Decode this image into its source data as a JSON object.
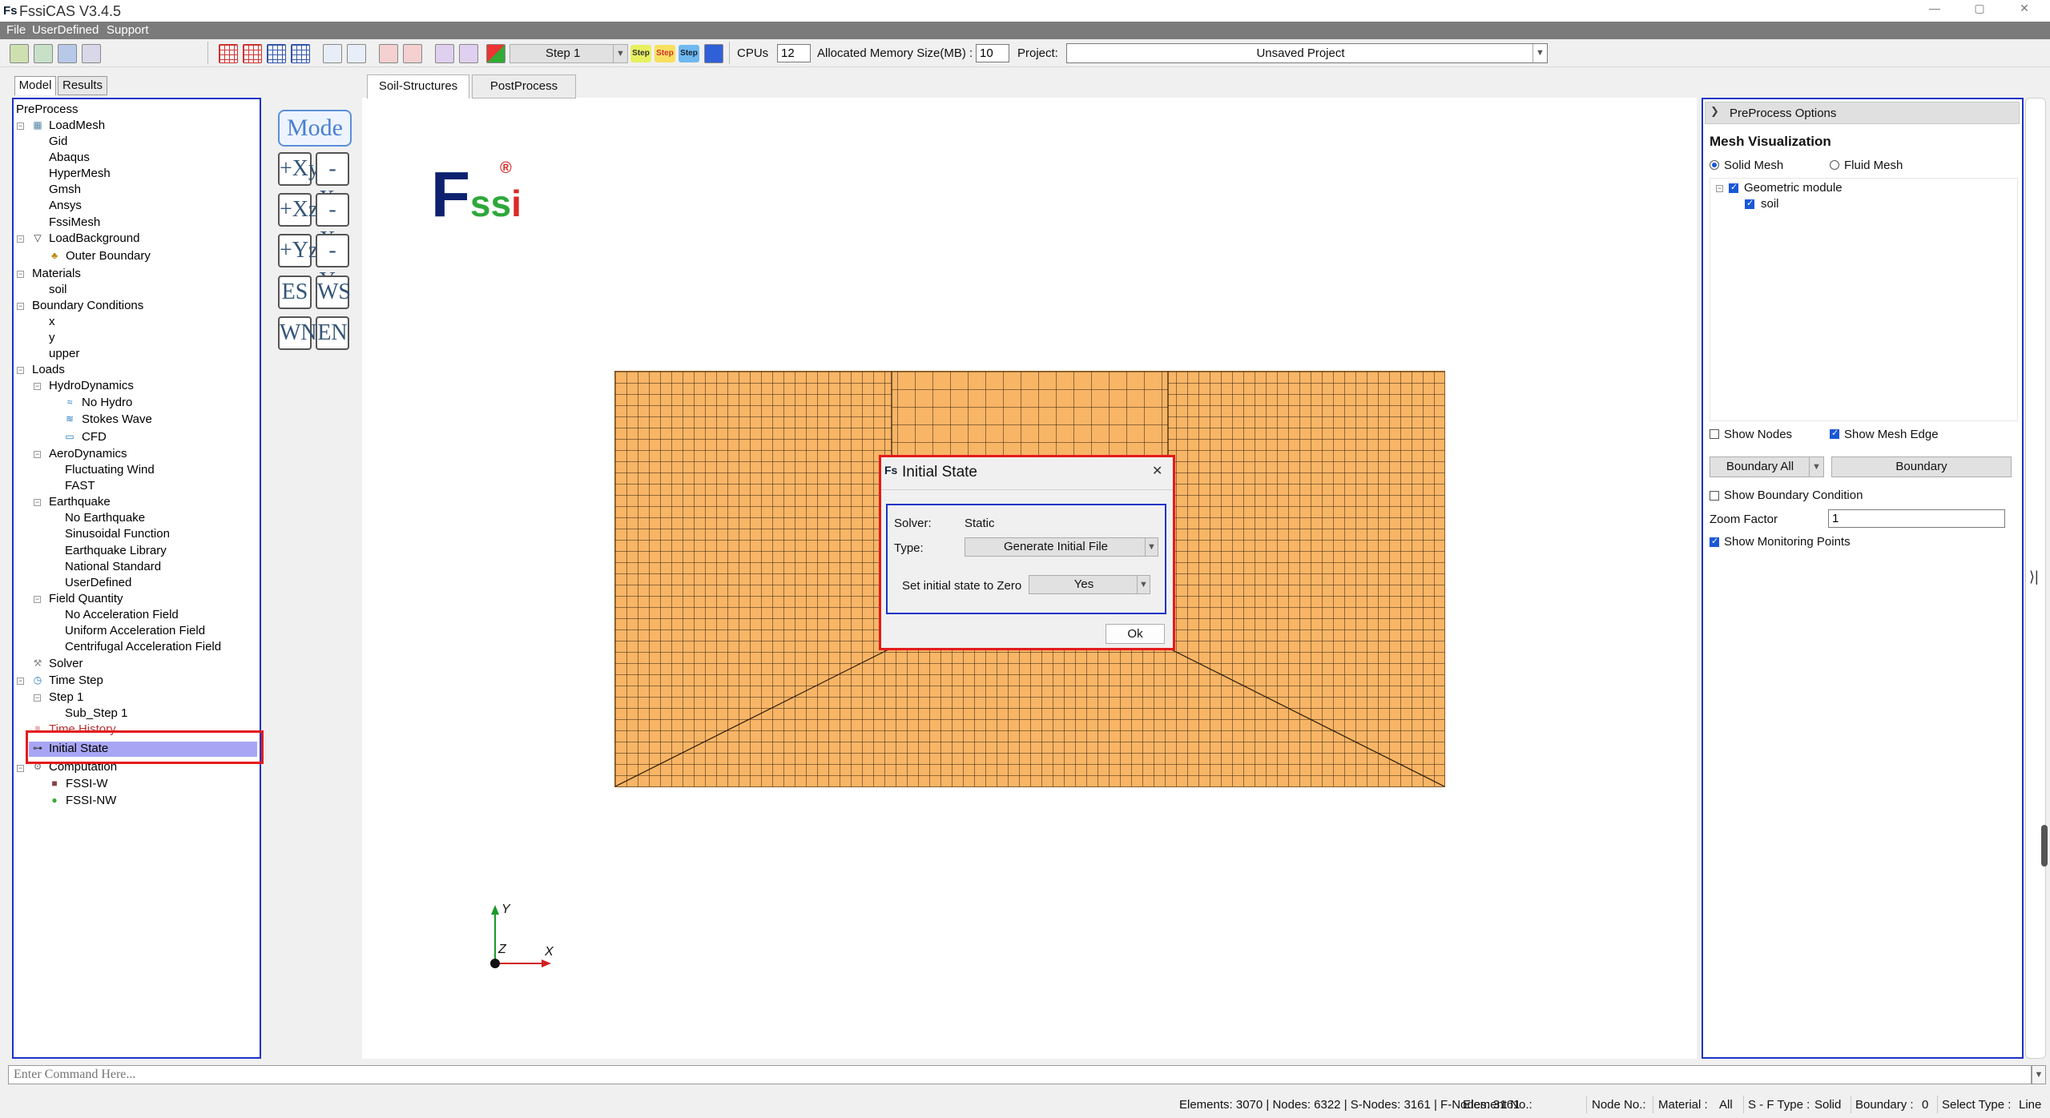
{
  "window": {
    "logo": "Fs",
    "title": "FssiCAS V3.4.5"
  },
  "menu": [
    "File",
    "UserDefined",
    "Support"
  ],
  "toolbar": {
    "step_select": "Step 1",
    "step_icons": [
      "Step",
      "Step",
      "Step"
    ],
    "cpus_label": "CPUs",
    "cpus_value": "12",
    "memory_label": "Allocated Memory Size(MB) :",
    "memory_value": "10",
    "project_label": "Project:",
    "project_value": "Unsaved Project"
  },
  "left_tabs": [
    "Model",
    "Results"
  ],
  "tree": {
    "root": "PreProcess",
    "load_mesh": {
      "label": "LoadMesh",
      "items": [
        "Gid",
        "Abaqus",
        "HyperMesh",
        "Gmsh",
        "Ansys",
        "FssiMesh"
      ]
    },
    "load_background": {
      "label": "LoadBackground",
      "items": [
        "Outer Boundary"
      ]
    },
    "materials": {
      "label": "Materials",
      "items": [
        "soil"
      ]
    },
    "boundary_conditions": {
      "label": "Boundary Conditions",
      "items": [
        "x",
        "y",
        "upper"
      ]
    },
    "loads": {
      "label": "Loads",
      "hydro": {
        "label": "HydroDynamics",
        "items": [
          "No Hydro",
          "Stokes Wave",
          "CFD"
        ]
      },
      "aero": {
        "label": "AeroDynamics",
        "items": [
          "Fluctuating Wind",
          "FAST"
        ]
      },
      "earthquake": {
        "label": "Earthquake",
        "items": [
          "No Earthquake",
          "Sinusoidal Function",
          "Earthquake Library",
          "National Standard",
          "UserDefined"
        ]
      },
      "field": {
        "label": "Field Quantity",
        "items": [
          "No Acceleration Field",
          "Uniform Acceleration Field",
          "Centrifugal Acceleration Field"
        ]
      }
    },
    "solver": "Solver",
    "time_step": {
      "label": "Time Step",
      "step": "Step 1",
      "sub_step": "Sub_Step 1"
    },
    "time_history": "Time History",
    "initial_state": "Initial State",
    "computation": {
      "label": "Computation",
      "items": [
        "FSSI-W",
        "FSSI-NW"
      ]
    }
  },
  "center_tabs": [
    "Soil-Structures",
    "PostProcess"
  ],
  "view_buttons": [
    "Mode",
    "+Xy",
    "-Xy",
    "+Xz",
    "-Xz",
    "+Yz",
    "-Yz",
    "ES",
    "WS",
    "WN",
    "EN"
  ],
  "logo": {
    "letters": [
      "F",
      "s",
      "s",
      "i"
    ],
    "mark": "®"
  },
  "axes": {
    "y": "Y",
    "z": "Z",
    "x": "X"
  },
  "dialog": {
    "title": "Initial State",
    "solver_label": "Solver:",
    "solver_value": "Static",
    "type_label": "Type:",
    "type_value": "Generate Initial File",
    "zero_label": "Set initial state to Zero",
    "zero_value": "Yes",
    "ok": "Ok"
  },
  "right_panel": {
    "header": "PreProcess Options",
    "section": "Mesh Visualization",
    "radio_solid": "Solid Mesh",
    "radio_fluid": "Fluid Mesh",
    "geo_module": "Geometric module",
    "geo_item": "soil",
    "show_nodes": "Show Nodes",
    "show_mesh_edge": "Show Mesh Edge",
    "boundary_all": "Boundary All",
    "boundary_btn": "Boundary",
    "show_bc": "Show Boundary Condition",
    "zoom_label": "Zoom Factor",
    "zoom_value": "1",
    "show_monitor": "Show Monitoring Points"
  },
  "command": {
    "placeholder": "Enter Command Here..."
  },
  "status": {
    "counts": "Elements: 3070 | Nodes: 6322 | S-Nodes: 3161 | F-Nodes: 3161",
    "element_no": "Element No.:",
    "node_no": "Node No.:",
    "material_label": "Material :",
    "material_value": "All",
    "sf_label": "S - F Type :",
    "sf_value": "Solid",
    "boundary_label": "Boundary :",
    "boundary_value": "0",
    "select_label": "Select Type :",
    "select_value": "Line"
  },
  "colors": {
    "accent_blue": "#1a33c8",
    "highlight_red": "#e41b1b",
    "mesh_fill": "#f8b566",
    "selection": "#a8a6f4"
  }
}
